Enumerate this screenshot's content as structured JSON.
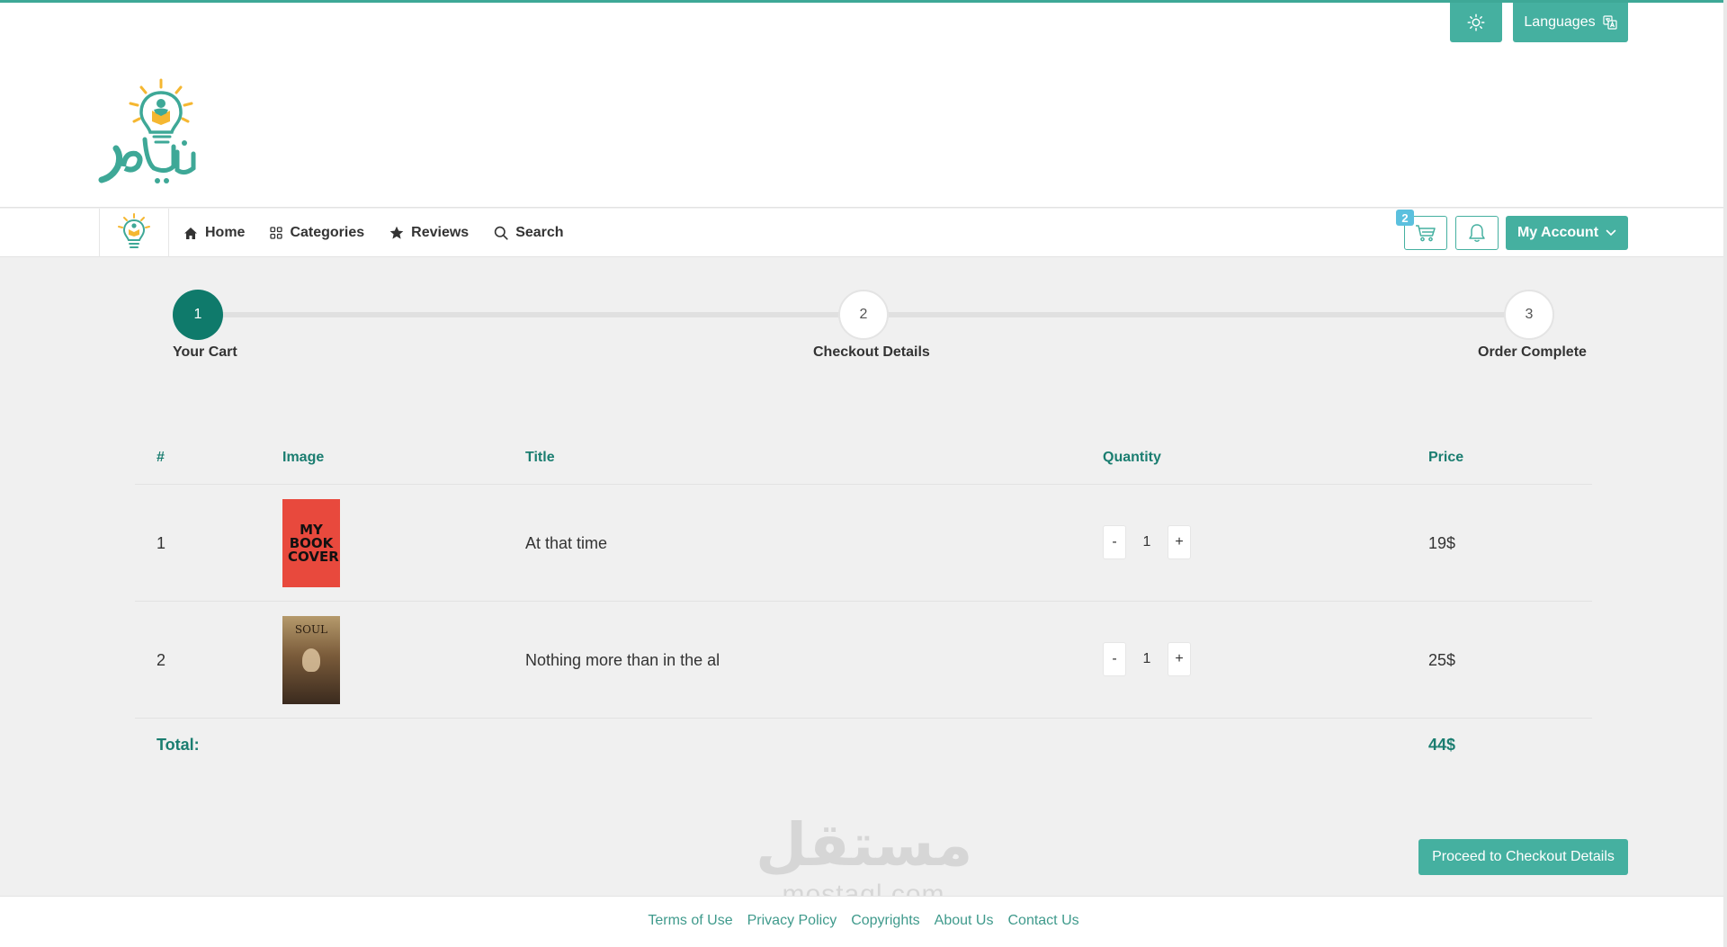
{
  "header": {
    "theme_icon": "sun-icon",
    "languages_label": "Languages",
    "languages_icon": "translate-icon",
    "logo_icon": "lightbulb-reader-logo",
    "colors": {
      "accent": "#45b0a0",
      "accent_dark": "#0f7a6b",
      "heading": "#1a7d70",
      "logo_yellow": "#f5b731"
    }
  },
  "nav": {
    "items": [
      {
        "label": "Home",
        "icon": "home-icon"
      },
      {
        "label": "Categories",
        "icon": "grid-icon"
      },
      {
        "label": "Reviews",
        "icon": "star-icon"
      },
      {
        "label": "Search",
        "icon": "search-icon"
      }
    ],
    "cart_count": "2",
    "cart_icon": "cart-icon",
    "bell_icon": "bell-icon",
    "account_label": "My Account",
    "account_icon": "chevron-down-icon"
  },
  "steps": [
    {
      "number": "1",
      "label": "Your Cart",
      "active": true
    },
    {
      "number": "2",
      "label": "Checkout Details",
      "active": false
    },
    {
      "number": "3",
      "label": "Order Complete",
      "active": false
    }
  ],
  "table": {
    "headers": {
      "index": "#",
      "image": "Image",
      "title": "Title",
      "quantity": "Quantity",
      "price": "Price"
    },
    "rows": [
      {
        "index": "1",
        "cover_text": "MY BOOK COVER",
        "title": "At that time",
        "qty_minus": "-",
        "quantity": "1",
        "qty_plus": "+",
        "price": "19$"
      },
      {
        "index": "2",
        "cover_text": "SOUL",
        "title": "Nothing more than in the al",
        "qty_minus": "-",
        "quantity": "1",
        "qty_plus": "+",
        "price": "25$"
      }
    ],
    "total_label": "Total:",
    "total_value": "44$"
  },
  "proceed_label": "Proceed to Checkout Details",
  "watermark": {
    "arabic": "مستقل",
    "latin": "mostaql.com"
  },
  "footer": {
    "links": [
      "Terms of Use",
      "Privacy Policy",
      "Copyrights",
      "About Us",
      "Contact Us"
    ]
  }
}
